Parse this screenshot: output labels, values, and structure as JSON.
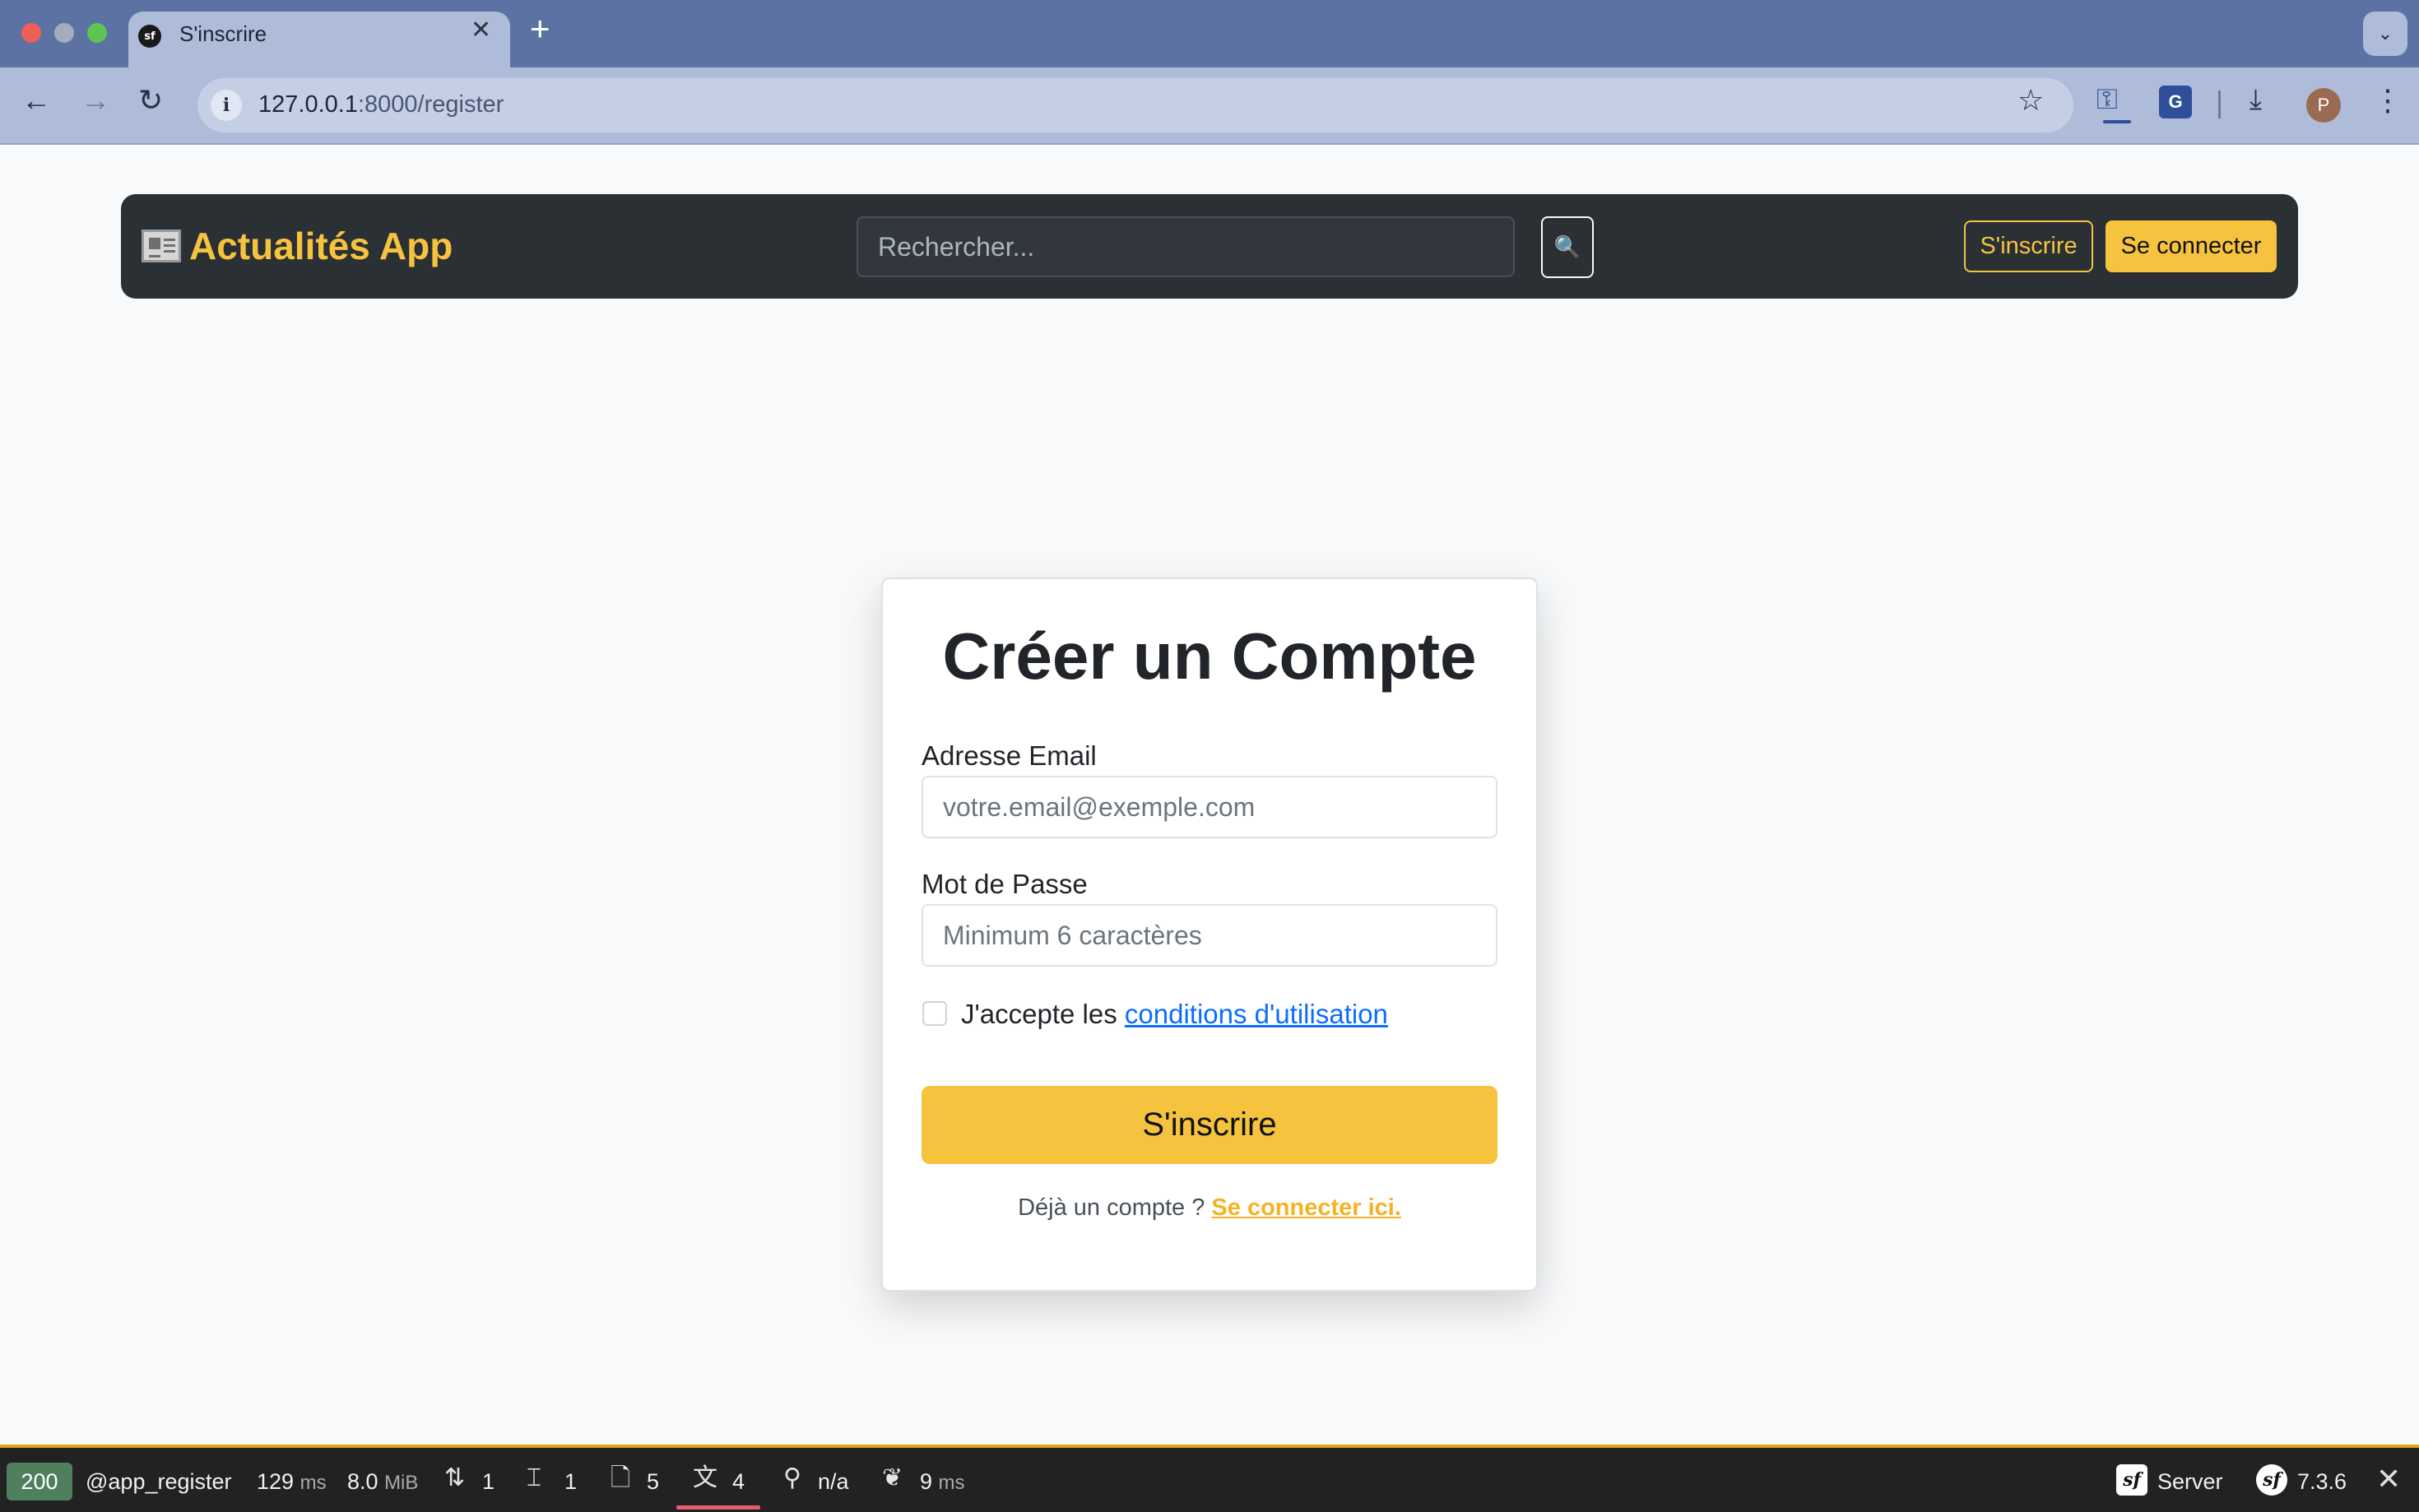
{
  "browser": {
    "tab_title": "S'inscrire",
    "tab_favicon": "sf",
    "new_tab_icon": "+",
    "url_host": "127.0.0.1",
    "url_rest": ":8000/register",
    "profile_initial": "P"
  },
  "navbar": {
    "brand_label": "Actualités App",
    "search_placeholder": "Rechercher...",
    "search_icon": "🔍",
    "register_label": "S'inscrire",
    "login_label": "Se connecter"
  },
  "form": {
    "title": "Créer un Compte",
    "email_label": "Adresse Email",
    "email_placeholder": "votre.email@exemple.com",
    "password_label": "Mot de Passe",
    "password_placeholder": "Minimum 6 caractères",
    "terms_prefix": "J'accepte les ",
    "terms_link": "conditions d'utilisation",
    "submit_label": "S'inscrire",
    "login_prompt": "Déjà un compte ? ",
    "login_link": "Se connecter ici."
  },
  "debug_toolbar": {
    "status_code": "200",
    "route": "@app_register",
    "time_value": "129",
    "time_unit": "ms",
    "memory_value": "8.0",
    "memory_unit": "MiB",
    "requests_count": "1",
    "forms_count": "1",
    "logs_count": "5",
    "translation_count": "4",
    "user": "n/a",
    "twig_value": "9",
    "twig_unit": "ms",
    "server_label": "Server",
    "version": "7.3.6"
  }
}
